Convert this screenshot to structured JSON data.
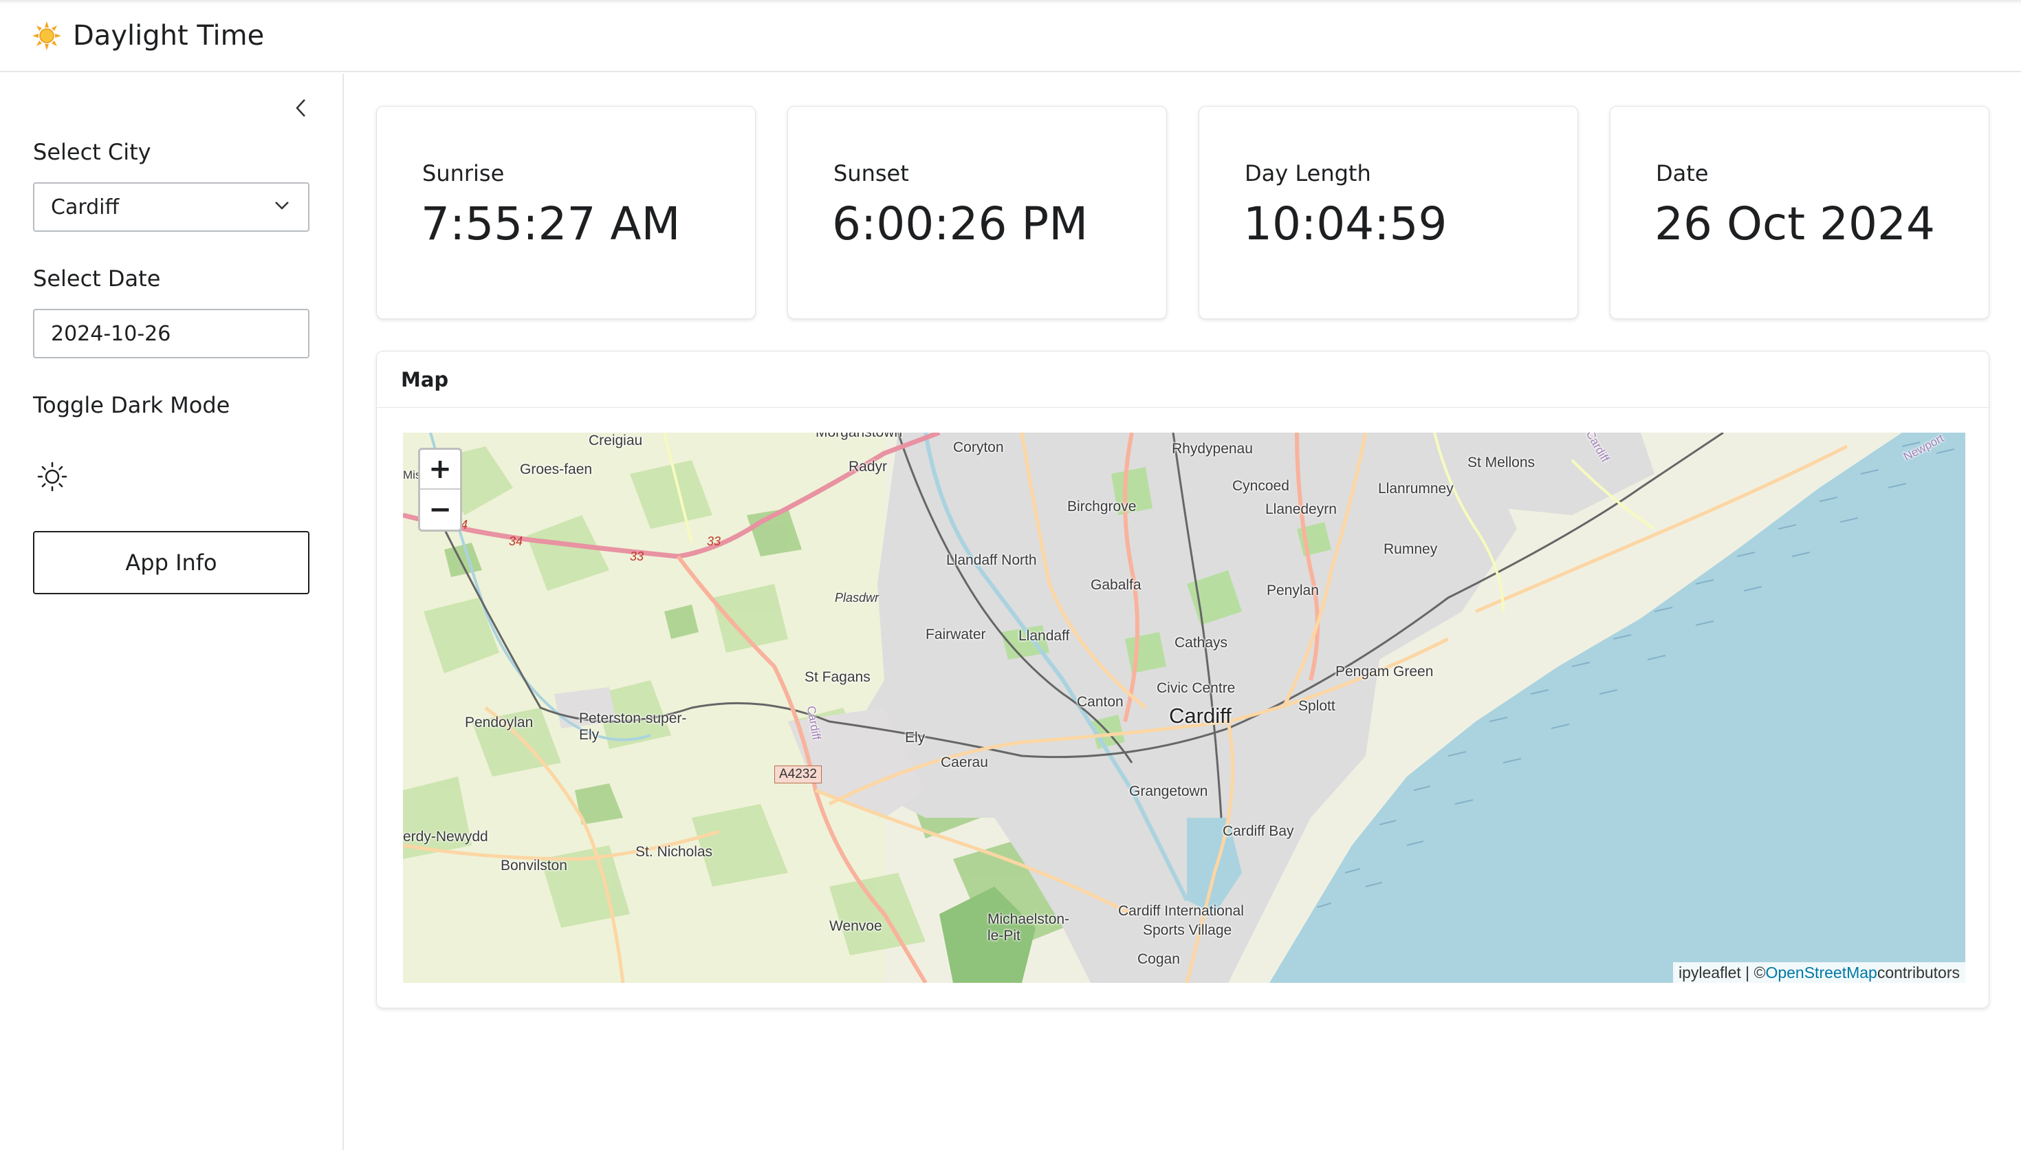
{
  "header": {
    "logo_icon": "sun-emoji",
    "title": "Daylight Time"
  },
  "sidebar": {
    "collapse_icon": "chevron-left-icon",
    "city_label": "Select City",
    "city_value": "Cardiff",
    "date_label": "Select Date",
    "date_value": "2024-10-26",
    "dark_mode_label": "Toggle Dark Mode",
    "theme_icon": "sun-outline-icon",
    "app_info_label": "App Info"
  },
  "cards": [
    {
      "title": "Sunrise",
      "value": "7:55:27 AM"
    },
    {
      "title": "Sunset",
      "value": "6:00:26 PM"
    },
    {
      "title": "Day Length",
      "value": "10:04:59"
    },
    {
      "title": "Date",
      "value": "26 Oct 2024"
    }
  ],
  "map": {
    "header": "Map",
    "zoom_in": "+",
    "zoom_out": "−",
    "attribution_prefix": "ipyleaflet | © ",
    "attribution_link": "OpenStreetMap",
    "attribution_suffix": " contributors",
    "places": {
      "creigiau": "Creigiau",
      "groes_faen": "Groes-faen",
      "morganstown": "Morganstown",
      "radyr": "Radyr",
      "coryton": "Coryton",
      "rhydypenau": "Rhydypenau",
      "birchgrove": "Birchgrove",
      "cyncoed": "Cyncoed",
      "llanedeyrn": "Llanedeyrn",
      "llanrumney": "Llanrumney",
      "st_mellons": "St Mellons",
      "rumney": "Rumney",
      "llandaff_north": "Llandaff North",
      "gabalfa": "Gabalfa",
      "penylan": "Penylan",
      "plasdwr": "Plasdwr",
      "fairwater": "Fairwater",
      "llandaff": "Llandaff",
      "cathays": "Cathays",
      "pengam_green": "Pengam Green",
      "st_fagans": "St Fagans",
      "civic_centre": "Civic Centre",
      "canton": "Canton",
      "cardiff": "Cardiff",
      "splott": "Splott",
      "pendoylan": "Pendoylan",
      "peterston": "Peterston-super-\nEly",
      "ely": "Ely",
      "caerau": "Caerau",
      "grangetown": "Grangetown",
      "cardiff_bay": "Cardiff Bay",
      "cerdy_newydd": "erdy-Newydd",
      "bonvilston": "Bonvilston",
      "st_nicholas": "St. Nicholas",
      "wenvoe": "Wenvoe",
      "michaelston": "Michaelston-\nle-Pit",
      "cardiff_intl": "Cardiff International",
      "sports_village": "Sports Village",
      "cogan": "Cogan",
      "newport": "Newport",
      "cardiff_road": "Cardiff",
      "a4232": "A4232",
      "r34": "34",
      "r33a": "33",
      "r33b": "33",
      "r4": "4",
      "mis": "Mis"
    }
  },
  "colors": {
    "sea": "#aad3df",
    "urban": "#dcdcdc",
    "land": "#f2efe9",
    "green": "#c8e6b0",
    "motorway": "#e892a2",
    "primary": "#fcd6a4",
    "link": "#0078a8"
  }
}
